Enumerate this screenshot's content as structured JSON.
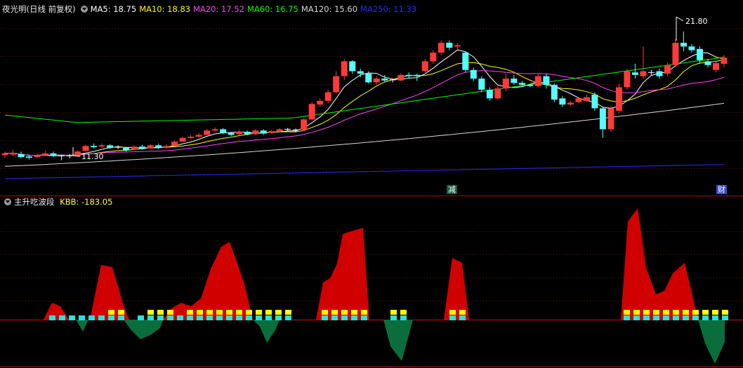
{
  "header": {
    "title": "夜光明(日线 前复权)",
    "ma": [
      {
        "label": "MA5: 18.75",
        "color": "#ffffff"
      },
      {
        "label": "MA10: 18.83",
        "color": "#ffff00"
      },
      {
        "label": "MA20: 17.52",
        "color": "#ff44ff"
      },
      {
        "label": "MA60: 16.75",
        "color": "#00ff00"
      },
      {
        "label": "MA120: 15.60",
        "color": "#d8d8d8"
      },
      {
        "label": "MA250: 11.33",
        "color": "#2a2aff"
      }
    ]
  },
  "indicator": {
    "title": "主升吃波段",
    "kbb_label": "KBB: -183.05",
    "kbb_color": "#ffff40"
  },
  "tags": {
    "jian": "减",
    "cai": "财"
  },
  "colors": {
    "up": "#ff3a3a",
    "down": "#54ffff",
    "cross": "#ffffff",
    "red_area": "#d00000",
    "green_area": "#0a6e3c",
    "yellow": "#ffff00",
    "cyan": "#2be0e0"
  },
  "chart_data": {
    "type": "candlestick",
    "y_range": [
      9.5,
      23.0
    ],
    "annotations": {
      "high_label": "21.80",
      "low_label": "11.30"
    },
    "candles": [
      [
        11.8,
        11.95,
        11.6,
        12.1
      ],
      [
        11.85,
        12.0,
        11.7,
        12.25
      ],
      [
        11.9,
        11.65,
        11.55,
        12.1
      ],
      [
        11.7,
        11.6,
        11.45,
        11.85
      ],
      [
        11.65,
        11.8,
        11.55,
        11.95
      ],
      [
        11.8,
        11.95,
        11.7,
        12.15
      ],
      [
        11.95,
        11.8,
        11.65,
        12.1
      ],
      [
        11.75,
        11.72,
        11.4,
        11.85
      ],
      [
        11.75,
        11.7,
        11.55,
        11.9
      ],
      [
        11.72,
        12.1,
        11.7,
        12.2
      ],
      [
        12.15,
        12.55,
        12.1,
        12.65
      ],
      [
        12.55,
        12.45,
        12.35,
        12.75
      ],
      [
        12.5,
        12.6,
        12.4,
        12.75
      ],
      [
        12.6,
        12.4,
        12.3,
        12.7
      ],
      [
        12.4,
        12.45,
        12.3,
        12.6
      ],
      [
        12.4,
        12.2,
        12.1,
        12.5
      ],
      [
        12.25,
        12.5,
        12.2,
        12.6
      ],
      [
        12.5,
        12.3,
        12.25,
        12.65
      ],
      [
        12.35,
        12.6,
        12.3,
        12.7
      ],
      [
        12.6,
        12.4,
        12.3,
        12.75
      ],
      [
        12.4,
        12.55,
        12.35,
        12.7
      ],
      [
        12.55,
        12.9,
        12.5,
        13.0
      ],
      [
        12.9,
        13.2,
        12.85,
        13.3
      ],
      [
        13.2,
        13.3,
        13.1,
        13.45
      ],
      [
        13.3,
        13.45,
        13.2,
        13.6
      ],
      [
        13.45,
        13.8,
        13.4,
        13.9
      ],
      [
        13.8,
        13.9,
        13.7,
        14.05
      ],
      [
        13.9,
        13.6,
        13.5,
        14.0
      ],
      [
        13.6,
        13.45,
        13.35,
        13.7
      ],
      [
        13.5,
        13.7,
        13.4,
        13.85
      ],
      [
        13.7,
        13.5,
        13.4,
        13.8
      ],
      [
        13.5,
        13.8,
        13.45,
        13.9
      ],
      [
        13.8,
        13.55,
        13.45,
        13.9
      ],
      [
        13.6,
        13.75,
        13.55,
        13.85
      ],
      [
        13.75,
        13.9,
        13.65,
        14.0
      ],
      [
        13.9,
        13.85,
        13.75,
        14.0
      ],
      [
        13.85,
        13.8,
        13.7,
        13.95
      ],
      [
        13.85,
        14.7,
        13.8,
        14.8
      ],
      [
        14.7,
        15.95,
        14.6,
        16.1
      ],
      [
        15.9,
        16.2,
        15.7,
        16.4
      ],
      [
        16.2,
        16.9,
        16.0,
        17.1
      ],
      [
        16.9,
        18.2,
        16.8,
        18.6
      ],
      [
        18.2,
        19.4,
        17.9,
        19.6
      ],
      [
        19.4,
        18.6,
        18.4,
        19.5
      ],
      [
        18.6,
        18.4,
        18.1,
        18.8
      ],
      [
        18.4,
        17.7,
        17.6,
        18.6
      ],
      [
        17.7,
        18.0,
        17.5,
        18.2
      ],
      [
        18.0,
        17.85,
        17.7,
        18.3
      ],
      [
        17.9,
        17.85,
        17.7,
        18.0
      ],
      [
        17.85,
        18.3,
        17.8,
        18.4
      ],
      [
        18.3,
        18.2,
        18.0,
        18.5
      ],
      [
        18.3,
        18.2,
        17.8,
        18.4
      ],
      [
        18.6,
        19.4,
        18.5,
        19.6
      ],
      [
        19.4,
        20.1,
        19.2,
        20.3
      ],
      [
        20.1,
        20.9,
        19.9,
        21.1
      ],
      [
        20.9,
        20.5,
        20.3,
        21.1
      ],
      [
        20.6,
        20.7,
        20.4,
        20.9
      ],
      [
        20.1,
        18.7,
        18.5,
        20.2
      ],
      [
        18.7,
        18.0,
        17.8,
        18.9
      ],
      [
        18.0,
        17.1,
        16.9,
        18.2
      ],
      [
        17.1,
        16.4,
        16.2,
        17.3
      ],
      [
        16.4,
        17.2,
        16.3,
        17.4
      ],
      [
        17.2,
        18.0,
        17.0,
        18.4
      ],
      [
        18.0,
        17.65,
        17.5,
        18.3
      ],
      [
        17.65,
        17.5,
        17.4,
        17.8
      ],
      [
        17.5,
        17.4,
        17.3,
        17.6
      ],
      [
        17.4,
        18.2,
        17.3,
        18.4
      ],
      [
        18.2,
        17.5,
        17.2,
        18.4
      ],
      [
        17.5,
        16.3,
        16.1,
        17.6
      ],
      [
        16.4,
        15.9,
        15.7,
        16.6
      ],
      [
        15.9,
        16.05,
        15.8,
        16.2
      ],
      [
        16.1,
        16.4,
        16.0,
        16.5
      ],
      [
        16.2,
        16.5,
        16.1,
        16.7
      ],
      [
        16.7,
        15.6,
        15.4,
        16.9
      ],
      [
        15.6,
        13.9,
        13.2,
        15.7
      ],
      [
        13.9,
        15.6,
        13.7,
        15.8
      ],
      [
        15.4,
        17.3,
        15.2,
        17.6
      ],
      [
        17.3,
        18.6,
        17.1,
        18.8
      ],
      [
        18.5,
        18.3,
        18.0,
        19.2
      ],
      [
        18.2,
        18.6,
        18.0,
        20.6
      ],
      [
        18.5,
        18.5,
        18.3,
        18.7
      ],
      [
        18.6,
        18.2,
        18.0,
        18.8
      ],
      [
        18.4,
        19.1,
        18.2,
        19.3
      ],
      [
        19.1,
        20.9,
        18.9,
        21.2
      ],
      [
        20.9,
        20.6,
        20.2,
        21.8
      ],
      [
        20.6,
        20.3,
        20.1,
        20.8
      ],
      [
        20.4,
        19.5,
        19.2,
        20.6
      ],
      [
        19.4,
        19.1,
        18.9,
        19.6
      ],
      [
        18.7,
        19.25,
        18.5,
        19.4
      ],
      [
        19.2,
        19.7,
        18.9,
        19.9
      ]
    ]
  }
}
